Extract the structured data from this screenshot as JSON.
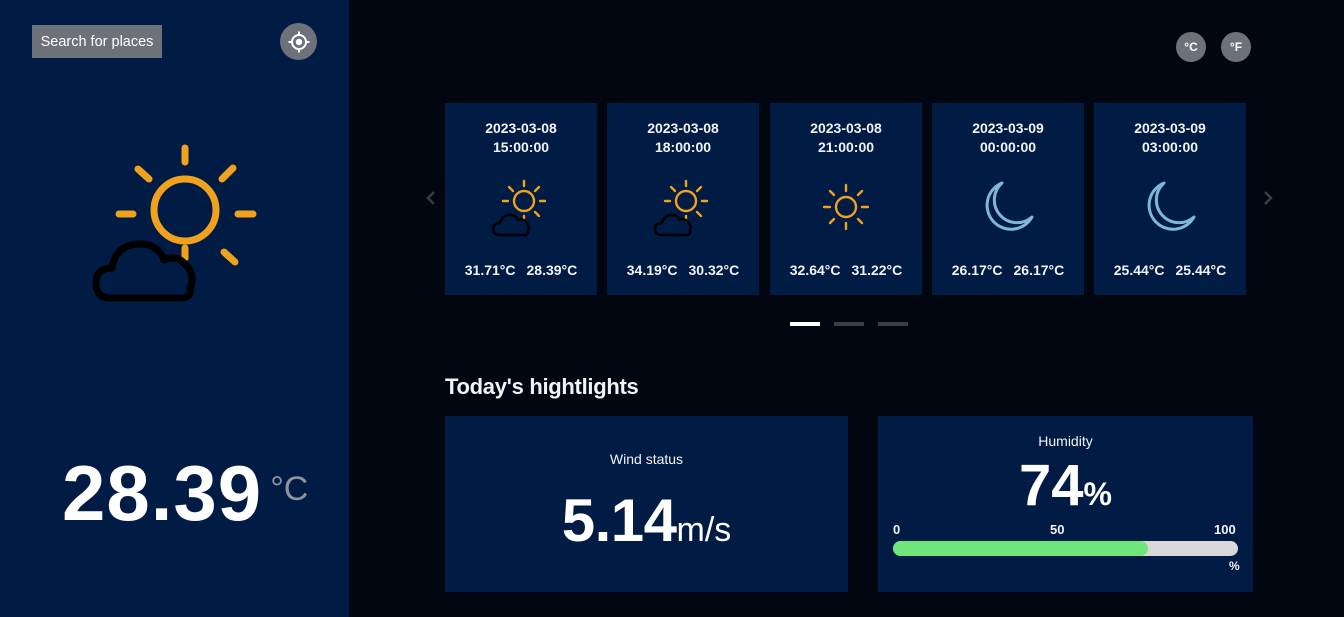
{
  "sidebar": {
    "search_label": "Search for places",
    "locate_icon": "crosshair-icon",
    "current_icon": "partly-sunny-icon",
    "temperature": "28.39",
    "temperature_unit": "°C"
  },
  "units": {
    "celsius": "°C",
    "fahrenheit": "°F"
  },
  "forecast": [
    {
      "date": "2023-03-08",
      "time": "15:00:00",
      "icon": "partly-sunny-icon",
      "max": "31.71°C",
      "min": "28.39°C"
    },
    {
      "date": "2023-03-08",
      "time": "18:00:00",
      "icon": "partly-sunny-icon",
      "max": "34.19°C",
      "min": "30.32°C"
    },
    {
      "date": "2023-03-08",
      "time": "21:00:00",
      "icon": "sun-icon",
      "max": "32.64°C",
      "min": "31.22°C"
    },
    {
      "date": "2023-03-09",
      "time": "00:00:00",
      "icon": "moon-icon",
      "max": "26.17°C",
      "min": "26.17°C"
    },
    {
      "date": "2023-03-09",
      "time": "03:00:00",
      "icon": "moon-icon",
      "max": "25.44°C",
      "min": "25.44°C"
    }
  ],
  "carousel": {
    "active_page": 1,
    "pages": 3
  },
  "highlights": {
    "title": "Today's hightlights",
    "wind": {
      "label": "Wind status",
      "value": "5.14",
      "unit": "m/s"
    },
    "humidity": {
      "label": "Humidity",
      "value": "74",
      "unit": "%",
      "scale_min": "0",
      "scale_mid": "50",
      "scale_max": "100",
      "scale_unit": "%",
      "percent": 74
    }
  },
  "colors": {
    "sidebar_bg": "#001b44",
    "page_bg": "#020611",
    "sun": "#f0a21e",
    "moon": "#7db7d9",
    "humidity_fill": "#6fe67b"
  }
}
